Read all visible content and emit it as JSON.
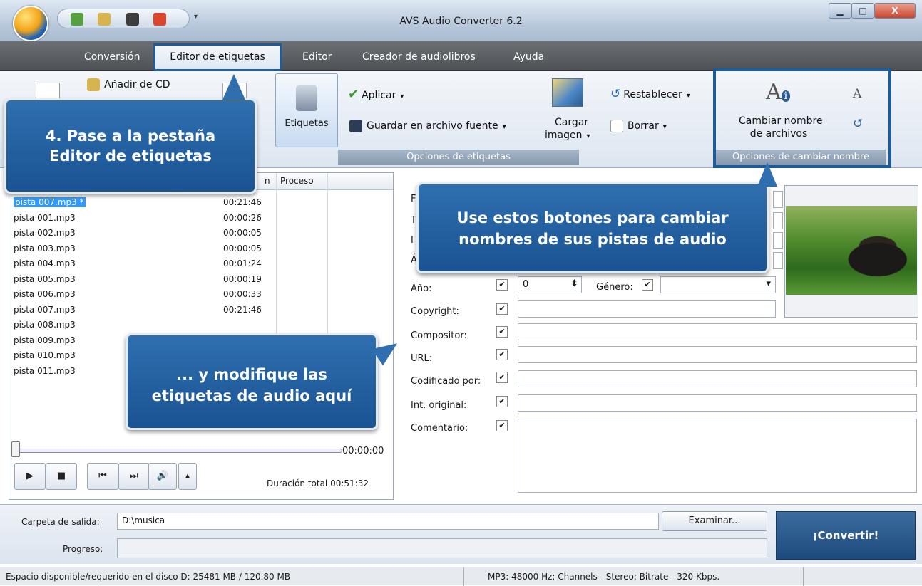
{
  "window": {
    "title": "AVS Audio Converter 6.2",
    "min": "▁",
    "max": "□",
    "close": "X"
  },
  "quick_access": {
    "dropdown": "▾"
  },
  "menu": {
    "tabs": [
      "Conversión",
      "Editor de etiquetas",
      "Editor",
      "Creador de audiolibros",
      "Ayuda"
    ],
    "active": "Editor de etiquetas"
  },
  "ribbon": {
    "add_cd": "Añadir de CD",
    "etiquetas": "Etiquetas",
    "aplicar": "Aplicar",
    "guardar": "Guardar en archivo fuente",
    "cargar": "Cargar",
    "imagen": "imagen",
    "restablecer": "Restablecer",
    "borrar": "Borrar",
    "cambiar_l1": "Cambiar nombre",
    "cambiar_l2": "de archivos",
    "group_tags": "Opciones de etiquetas",
    "group_rename": "Opciones de cambiar nombre",
    "caret": "▾"
  },
  "file_list": {
    "col_duration_partial": "n",
    "col_process": "Proceso",
    "rows": [
      {
        "name": "pista 007.mp3 *",
        "duration": "00:21:46"
      },
      {
        "name": "pista 001.mp3",
        "duration": "00:00:26"
      },
      {
        "name": "pista 002.mp3",
        "duration": "00:00:05"
      },
      {
        "name": "pista 003.mp3",
        "duration": "00:00:05"
      },
      {
        "name": "pista 004.mp3",
        "duration": "00:01:24"
      },
      {
        "name": "pista 005.mp3",
        "duration": "00:00:19"
      },
      {
        "name": "pista 006.mp3",
        "duration": "00:00:33"
      },
      {
        "name": "pista 007.mp3",
        "duration": "00:21:46"
      },
      {
        "name": "pista 008.mp3",
        "duration": ""
      },
      {
        "name": "pista 009.mp3",
        "duration": ""
      },
      {
        "name": "pista 010.mp3",
        "duration": ""
      },
      {
        "name": "pista 011.mp3",
        "duration": ""
      }
    ]
  },
  "player": {
    "time": "00:00:00",
    "total_label": "Duración total",
    "total": "00:51:32",
    "play": "▶",
    "stop": "■",
    "prev": "⏮",
    "next": "⏭",
    "volume": "🔊",
    "vol_up": "▴"
  },
  "tags": {
    "partial_labels": [
      "F",
      "T",
      "I",
      "Á"
    ],
    "year_label": "Año:",
    "year_value": "0",
    "genre_label": "Género:",
    "copyright": "Copyright:",
    "composer": "Compositor:",
    "url": "URL:",
    "encoded": "Codificado por:",
    "original": "Int. original:",
    "comment": "Comentario:",
    "check": "✔",
    "spin": "⬍",
    "dd": "▾"
  },
  "output": {
    "folder_label": "Carpeta de salida:",
    "folder": "D:\\musica",
    "browse": "Examinar...",
    "progress_label": "Progreso:",
    "convert": "¡Convertir!"
  },
  "status": {
    "disk": "Espacio disponible/requerido en el disco D: 25481 MB / 120.80 MB",
    "format": "MP3: 48000  Hz; Channels - Stereo; Bitrate - 320 Kbps."
  },
  "callouts": {
    "step4_l1": "4. Pase a la pestaña",
    "step4_l2": "Editor de etiquetas",
    "rename_l1": "Use estos botones para cambiar",
    "rename_l2": "nombres de sus pistas de audio",
    "tags_l1": "... y modifique las",
    "tags_l2": "etiquetas de audio aquí"
  }
}
